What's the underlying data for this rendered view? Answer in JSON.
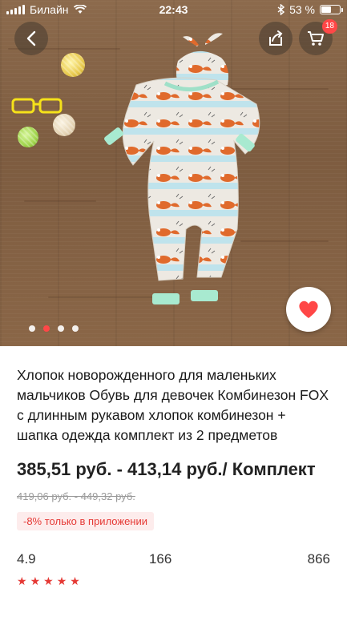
{
  "status_bar": {
    "carrier": "Билайн",
    "time": "22:43",
    "battery_percent": "53 %",
    "battery_level": 0.53
  },
  "header": {
    "cart_count": "18"
  },
  "gallery": {
    "image_count": 4,
    "active_index": 1
  },
  "product": {
    "title": "Хлопок новорожденного для маленьких мальчиков Обувь для девочек Комбинезон FOX с длинным рукавом хлопок комбинезон + шапка одежда комплект из 2 предметов",
    "price_range": "385,51 руб. - 413,14 руб./ Комплект",
    "old_price": "419,06 руб. - 449,32 руб.",
    "promo": "-8% только в приложении"
  },
  "stats": {
    "rating": "4.9",
    "reviews": "166",
    "orders": "866"
  },
  "colors": {
    "accent": "#ff4747",
    "promo_text": "#e53935",
    "promo_bg": "#fdecec"
  },
  "icons": {
    "back": "chevron-left-icon",
    "share": "share-icon",
    "cart": "cart-icon",
    "favorite": "heart-icon"
  }
}
